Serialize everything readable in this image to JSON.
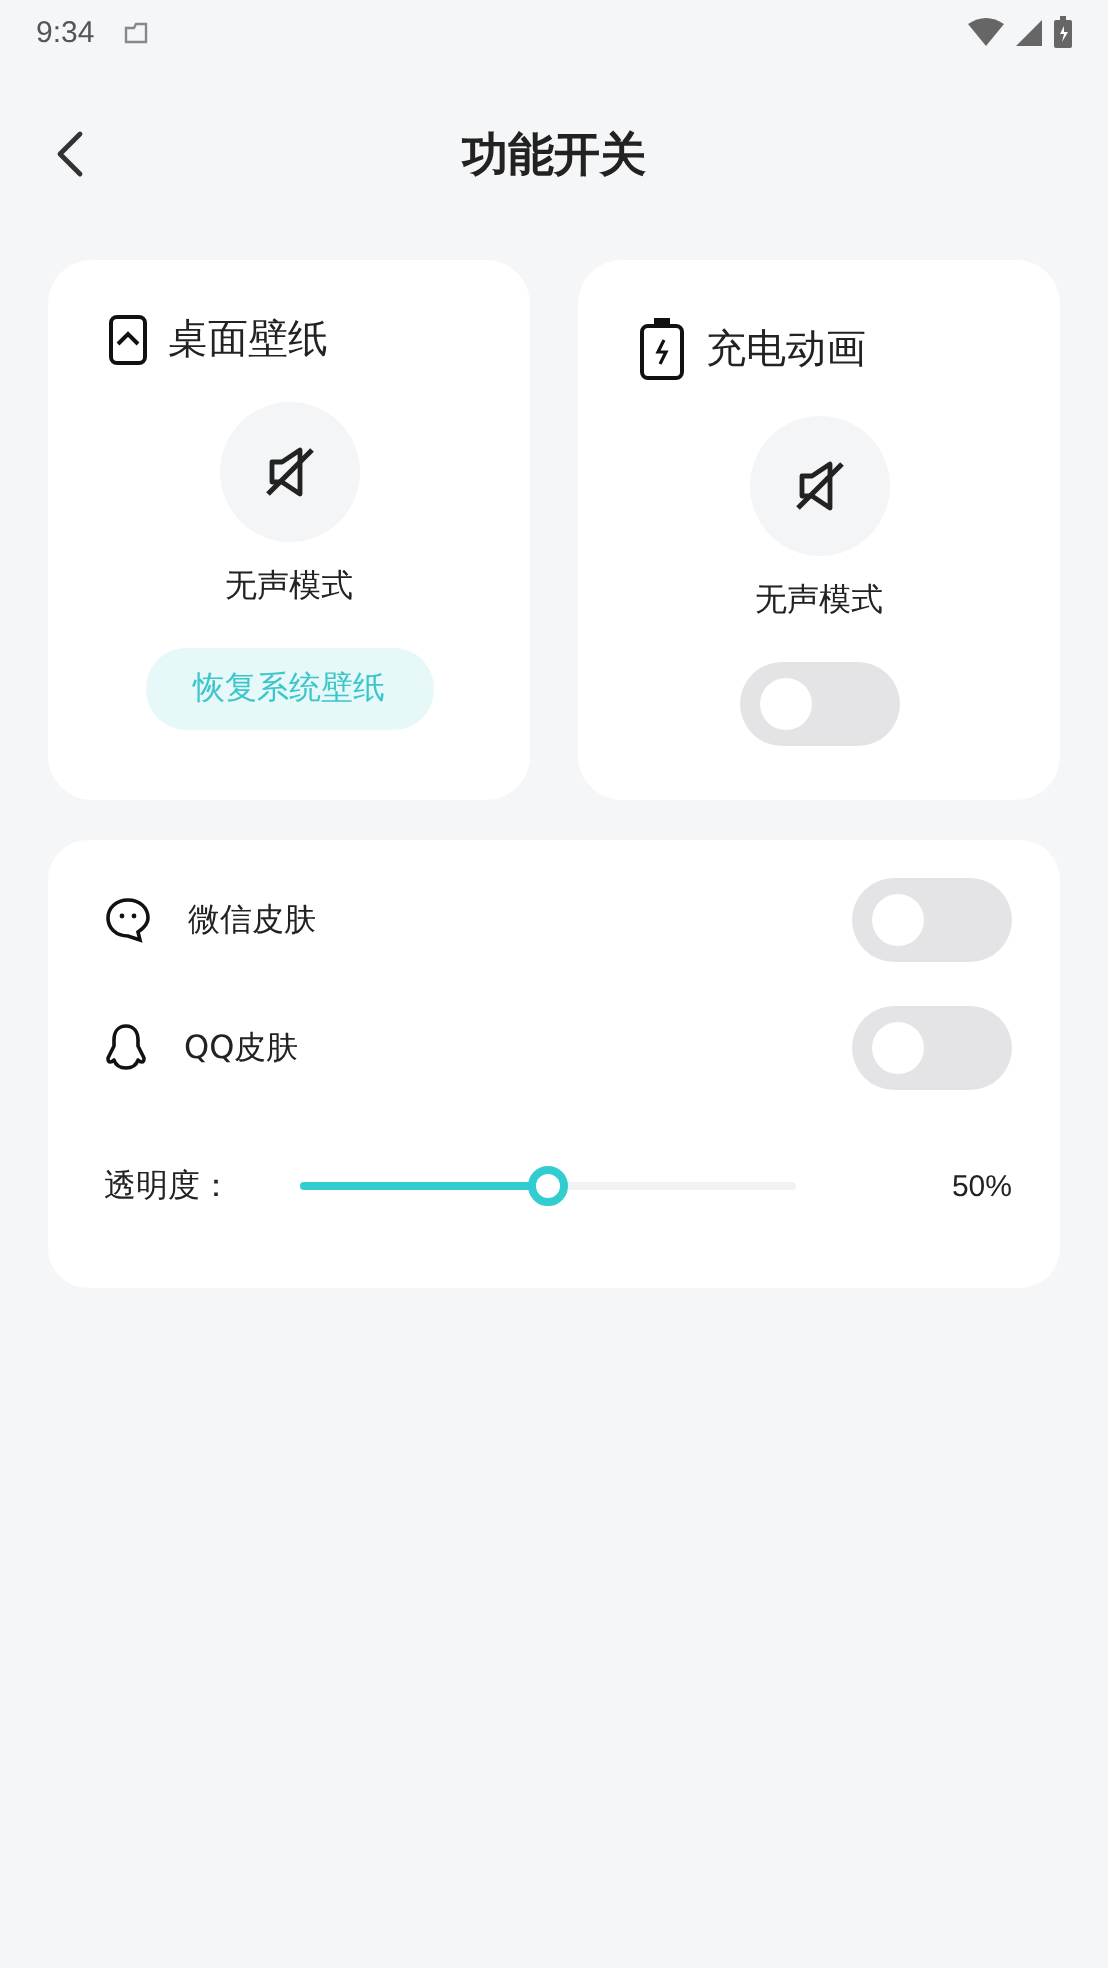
{
  "status_bar": {
    "time": "9:34"
  },
  "header": {
    "title": "功能开关"
  },
  "cards": [
    {
      "kind": "button",
      "title": "桌面壁纸",
      "mode_label": "无声模式",
      "action": "恢复系统壁纸"
    },
    {
      "kind": "toggle",
      "title": "充电动画",
      "mode_label": "无声模式",
      "on": false
    }
  ],
  "skins": [
    {
      "kind": "wechat",
      "label": "微信皮肤",
      "on": false
    },
    {
      "kind": "qq",
      "label": "QQ皮肤",
      "on": false
    }
  ],
  "opacity": {
    "label": "透明度：",
    "level": 0.5,
    "reading": "50%"
  }
}
